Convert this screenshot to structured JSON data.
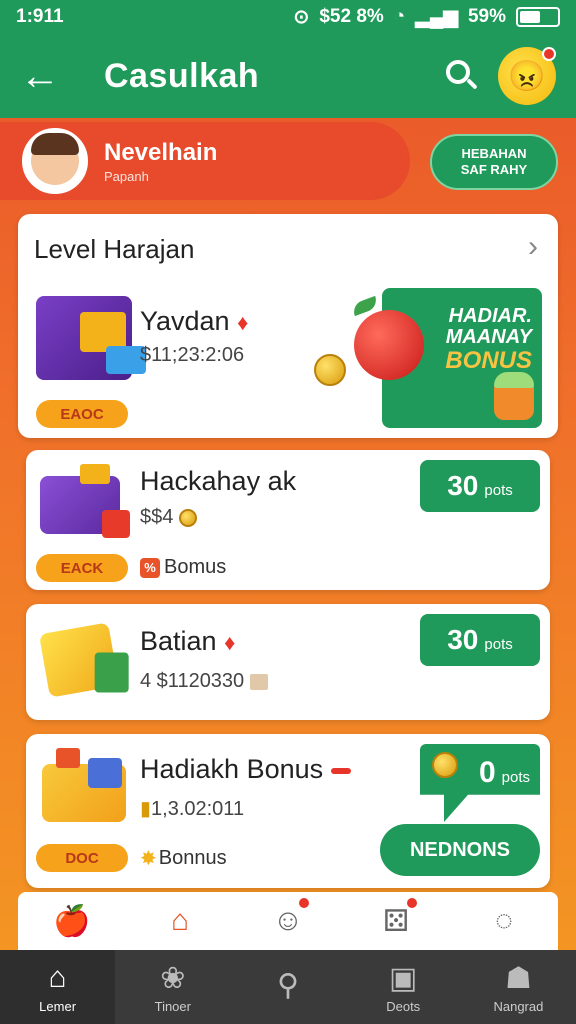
{
  "status": {
    "time": "1:911",
    "signal_text": "$52 8%",
    "battery_pct": "59%",
    "battery_level": 0.59
  },
  "appbar": {
    "title": "Casulkah"
  },
  "profile": {
    "name": "Nevelhain",
    "subtitle": "Papanh",
    "button_line1": "HEBAHAN",
    "button_line2": "SAF RAHY"
  },
  "level": {
    "heading": "Level Harajan",
    "item": {
      "title": "Yavdan",
      "value": "$11;23:2:06",
      "tag": "EAOC"
    },
    "promo": {
      "line1": "HADIAR.",
      "line2": "MAANAY",
      "line3": "BONUS"
    }
  },
  "items": [
    {
      "title": "Hackahay ak",
      "value": "$$4",
      "tag": "EACK",
      "bonus": "Bomus",
      "points": "30",
      "points_unit": "pots"
    },
    {
      "title": "Batian",
      "value": "4 $1120330",
      "points": "30",
      "points_unit": "pots"
    },
    {
      "title": "Hadiakh Bonus",
      "value": "1,3.02:011",
      "tag": "DOC",
      "bonus": "Bonnus",
      "points": "0",
      "points_unit": "pots",
      "button": "NEDNONS"
    }
  ],
  "bottom_nav": [
    {
      "label": "Lemer",
      "icon": "home-icon"
    },
    {
      "label": "Tinoer",
      "icon": "gift-icon"
    },
    {
      "label": "",
      "icon": "search-icon"
    },
    {
      "label": "Deots",
      "icon": "box-icon"
    },
    {
      "label": "Nangrad",
      "icon": "profile-icon"
    }
  ]
}
